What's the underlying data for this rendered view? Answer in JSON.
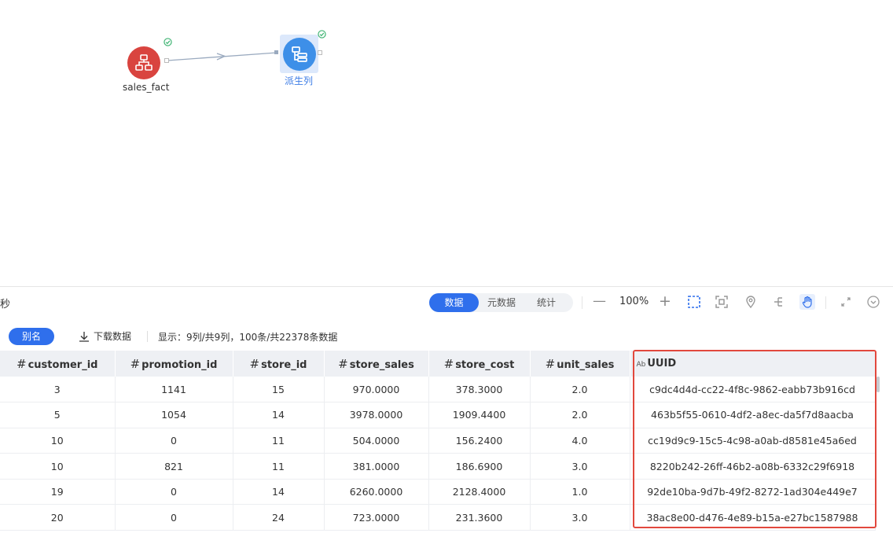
{
  "flow": {
    "source_node": {
      "label": "sales_fact",
      "icon": "database-icon"
    },
    "derive_node": {
      "label": "派生列",
      "icon": "derive-column-icon"
    }
  },
  "panel": {
    "elapsed_suffix": "秒",
    "tabs": [
      {
        "label": "数据",
        "active": true
      },
      {
        "label": "元数据",
        "active": false
      },
      {
        "label": "统计",
        "active": false
      }
    ],
    "zoom": "100%",
    "alias_label": "别名",
    "download_label": "下载数据",
    "summary": "显示：9列/共9列，100条/共22378条数据"
  },
  "table": {
    "columns": [
      {
        "label": "customer_id",
        "type": "#"
      },
      {
        "label": "promotion_id",
        "type": "#"
      },
      {
        "label": "store_id",
        "type": "#"
      },
      {
        "label": "store_sales",
        "type": "#"
      },
      {
        "label": "store_cost",
        "type": "#"
      },
      {
        "label": "unit_sales",
        "type": "#"
      },
      {
        "label": "UUID",
        "type": "Ab"
      }
    ],
    "rows": [
      [
        "3",
        "1141",
        "15",
        "970.0000",
        "378.3000",
        "2.0",
        "c9dc4d4d-cc22-4f8c-9862-eabb73b916cd"
      ],
      [
        "5",
        "1054",
        "14",
        "3978.0000",
        "1909.4400",
        "2.0",
        "463b5f55-0610-4df2-a8ec-da5f7d8aacba"
      ],
      [
        "10",
        "0",
        "11",
        "504.0000",
        "156.2400",
        "4.0",
        "cc19d9c9-15c5-4c98-a0ab-d8581e45a6ed"
      ],
      [
        "10",
        "821",
        "11",
        "381.0000",
        "186.6900",
        "3.0",
        "8220b242-26ff-46b2-a08b-6332c29f6918"
      ],
      [
        "19",
        "0",
        "14",
        "6260.0000",
        "2128.4000",
        "1.0",
        "92de10ba-9d7b-49f2-8272-1ad304e449e7"
      ],
      [
        "20",
        "0",
        "24",
        "723.0000",
        "231.3600",
        "3.0",
        "38ac8e00-d476-4e89-b15a-e27bc1587988"
      ]
    ]
  },
  "colors": {
    "accent": "#2f6fec",
    "source_node": "#d9443f",
    "derive_node": "#3d8fe8",
    "highlight": "#e2483d",
    "success": "#3cb371"
  }
}
